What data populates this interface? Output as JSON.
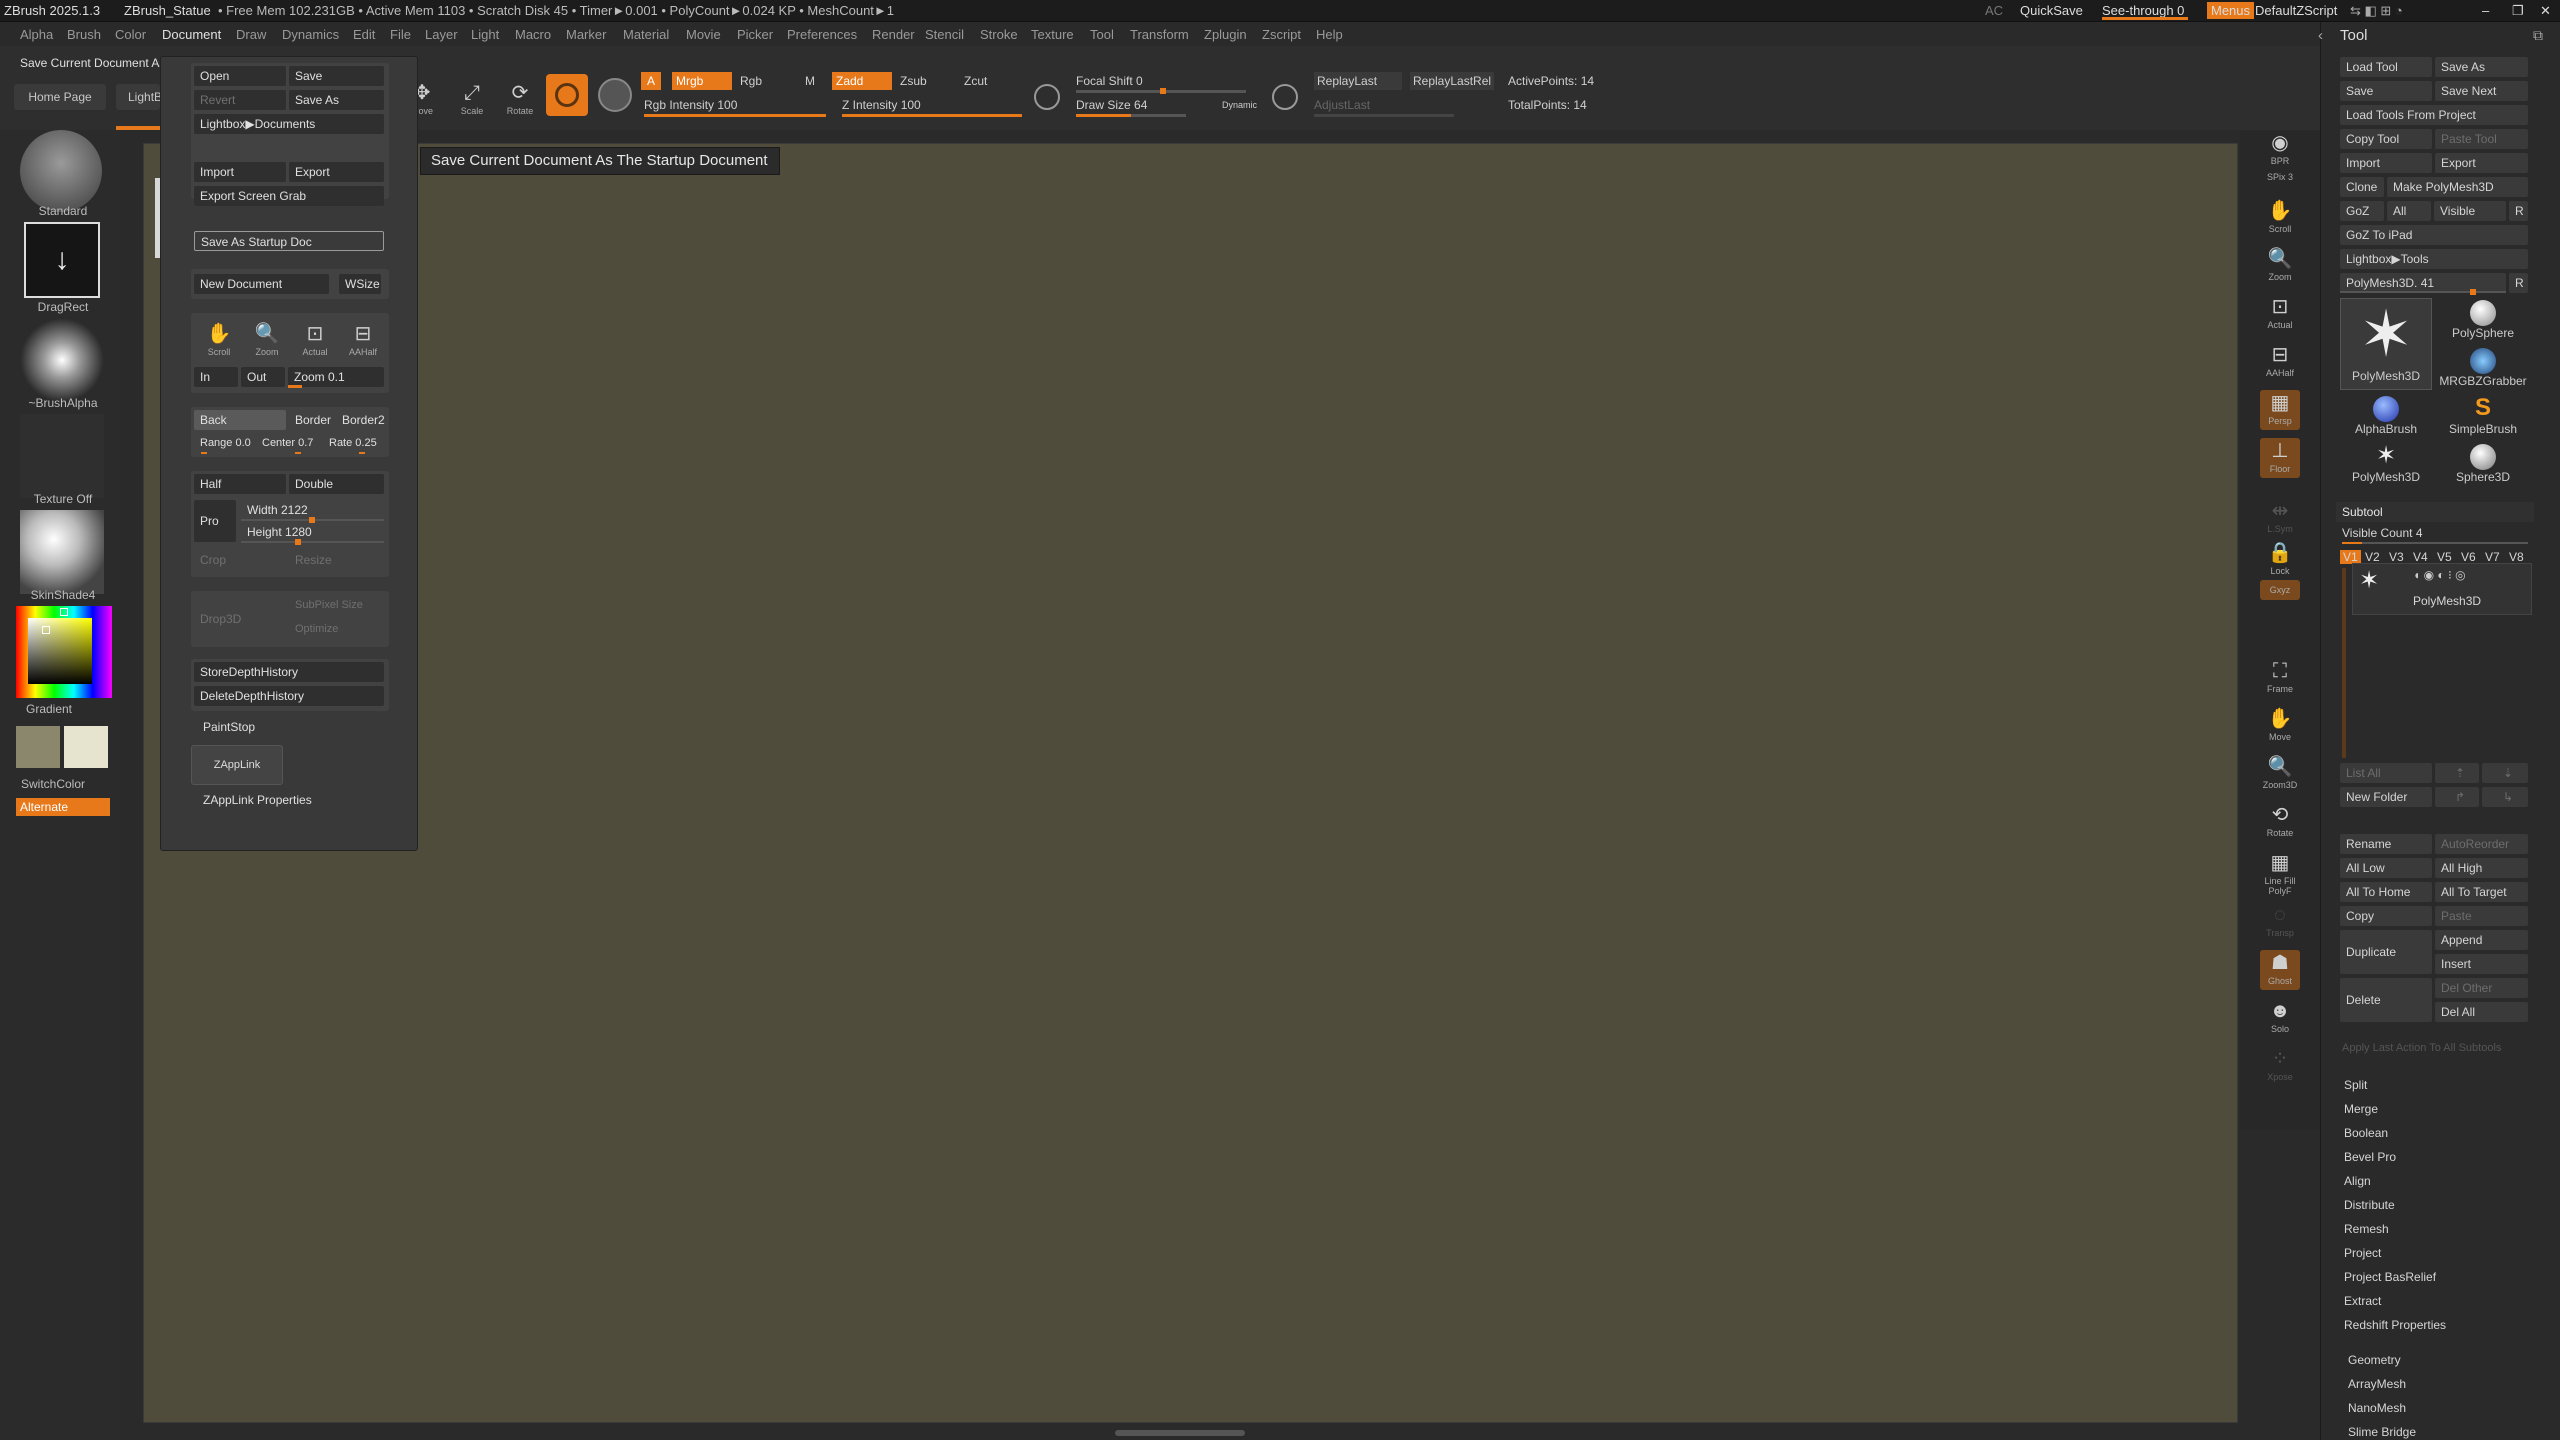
{
  "titlebar": {
    "app": "ZBrush 2025.1.3",
    "doc": "ZBrush_Statue",
    "stats": "• Free Mem 102.231GB • Active Mem 1103 • Scratch Disk 45 • Timer►0.001 • PolyCount►0.024 KP • MeshCount►1",
    "ac": "AC",
    "quicksave": "QuickSave",
    "seethrough": "See-through 0",
    "menus": "Menus",
    "defaultzscript": "DefaultZScript"
  },
  "menubar": [
    "Alpha",
    "Brush",
    "Color",
    "Document",
    "Draw",
    "Dynamics",
    "Edit",
    "File",
    "Layer",
    "Light",
    "Macro",
    "Marker",
    "Material",
    "Movie",
    "Picker",
    "Preferences",
    "Render",
    "Stencil",
    "Stroke",
    "Texture",
    "Tool",
    "Transform",
    "Zplugin",
    "Zscript",
    "Help"
  ],
  "toolbar": {
    "home": "Home Page",
    "lightbox": "LightBox",
    "crumb": "Save Current Document As The Startup Document",
    "move": "Move",
    "scale": "Scale",
    "rotate": "Rotate",
    "a": "A",
    "mrgb": "Mrgb",
    "rgb": "Rgb",
    "m": "M",
    "zadd": "Zadd",
    "zsub": "Zsub",
    "zcut": "Zcut",
    "rgb_intensity": "Rgb Intensity 100",
    "z_intensity": "Z Intensity 100",
    "focal": "Focal Shift 0",
    "drawsize": "Draw Size 64",
    "dynamic": "Dynamic",
    "replaylast": "ReplayLast",
    "replaylastrel": "ReplayLastRel",
    "adjustlast": "AdjustLast",
    "activepoints": "ActivePoints: 14",
    "totalpoints": "TotalPoints: 14"
  },
  "leftshelf": {
    "standard": "Standard",
    "dragrect": "DragRect",
    "brushalpha": "~BrushAlpha",
    "textureoff": "Texture Off",
    "skinshade": "SkinShade4",
    "gradient": "Gradient",
    "switchcolor": "SwitchColor",
    "alternate": "Alternate"
  },
  "tooltip": "Save Current Document As The Startup Document",
  "docmenu": {
    "open": "Open",
    "save": "Save",
    "revert": "Revert",
    "saveas": "Save As",
    "lightboxdocs": "Lightbox▶Documents",
    "import": "Import",
    "export": "Export",
    "screengrab": "Export Screen Grab",
    "startup": "Save As Startup Doc",
    "newdoc": "New Document",
    "wsize": "WSize",
    "scroll": "Scroll",
    "zoom": "Zoom",
    "actual": "Actual",
    "aahalf": "AAHalf",
    "in": "In",
    "out": "Out",
    "zoomval": "Zoom 0.1",
    "back": "Back",
    "border": "Border",
    "border2": "Border2",
    "range": "Range 0.0",
    "center": "Center 0.7",
    "rate": "Rate 0.25",
    "half": "Half",
    "double": "Double",
    "pro": "Pro",
    "width": "Width 2122",
    "height": "Height 1280",
    "crop": "Crop",
    "resize": "Resize",
    "drop3d": "Drop3D",
    "subpixel": "SubPixel Size",
    "optimize": "Optimize",
    "storedepth": "StoreDepthHistory",
    "deletedepth": "DeleteDepthHistory",
    "paintstop": "PaintStop",
    "zapplink": "ZAppLink",
    "zapplinkprops": "ZAppLink Properties"
  },
  "rightshelf": [
    "BPR",
    "SPix 3",
    "Scroll",
    "Zoom",
    "Actual",
    "AAHalf",
    "Persp",
    "Floor",
    "L.Sym",
    "Lock",
    "Gxyz",
    "",
    "",
    "Frame",
    "Move",
    "Zoom3D",
    "Rotate",
    "Line Fill PolyF",
    "Transp",
    "Ghost",
    "Solo",
    "Xpose"
  ],
  "toolpanel": {
    "title": "Tool",
    "loadtool": "Load Tool",
    "saveas": "Save As",
    "save": "Save",
    "savenext": "Save Next",
    "loadfromproject": "Load Tools From Project",
    "copytool": "Copy Tool",
    "pastetool": "Paste Tool",
    "import": "Import",
    "export": "Export",
    "clone": "Clone",
    "makepoly": "Make PolyMesh3D",
    "goz": "GoZ",
    "all": "All",
    "visible": "Visible",
    "r": "R",
    "goztoipad": "GoZ To iPad",
    "lightboxtools": "Lightbox▶Tools",
    "polymeshval": "PolyMesh3D. 41",
    "tools": [
      "PolyMesh3D",
      "PolySphere",
      "MRGBZGrabber",
      "AlphaBrush",
      "SimpleBrush",
      "PolyMesh3D",
      "Sphere3D"
    ],
    "subtool": "Subtool",
    "visiblecount": "Visible Count 4",
    "v": [
      "V1",
      "V2",
      "V3",
      "V4",
      "V5",
      "V6",
      "V7",
      "V8"
    ],
    "subtoolname": "PolyMesh3D",
    "listall": "List All",
    "newfolder": "New Folder",
    "rename": "Rename",
    "autoreorder": "AutoReorder",
    "alllow": "All Low",
    "allhigh": "All High",
    "alltohome": "All To Home",
    "alltotarget": "All To Target",
    "copy": "Copy",
    "paste": "Paste",
    "duplicate": "Duplicate",
    "append": "Append",
    "insert": "Insert",
    "delete": "Delete",
    "delother": "Del Other",
    "delall": "Del All",
    "applylast": "Apply Last Action To All Subtools",
    "sections": [
      "Split",
      "Merge",
      "Boolean",
      "Bevel Pro",
      "Align",
      "Distribute",
      "Remesh",
      "Project",
      "Project BasRelief",
      "Extract",
      "Redshift Properties"
    ],
    "sub2": [
      "Geometry",
      "ArrayMesh",
      "NanoMesh",
      "Slime Bridge"
    ]
  },
  "colors": {
    "accent": "#e8791b",
    "doc": "#4f4c3c"
  }
}
